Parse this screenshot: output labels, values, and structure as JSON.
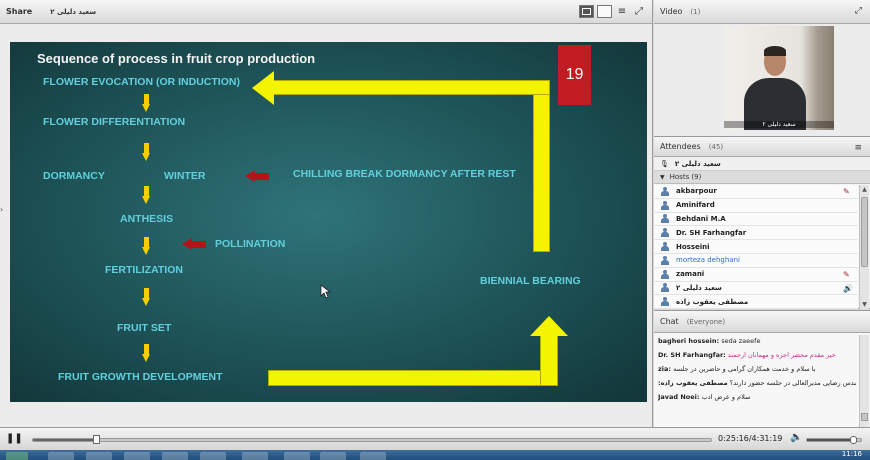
{
  "share": {
    "title": "Share",
    "presenter": "سعید دلیلی ۲"
  },
  "slide": {
    "title": "Sequence of process in fruit crop production",
    "number": "19",
    "steps": [
      "FLOWER EVOCATION (OR INDUCTION)",
      "FLOWER DIFFERENTIATION",
      "DORMANCY",
      "ANTHESIS",
      "FERTILIZATION",
      "FRUIT SET",
      "FRUIT GROWTH DEVELOPMENT"
    ],
    "winter": "WINTER",
    "chilling": "CHILLING BREAK DORMANCY AFTER REST",
    "pollination": "POLLINATION",
    "biennial": "BIENNIAL BEARING"
  },
  "video": {
    "title": "Video",
    "count": "(1)",
    "caption": "سعید دلیلی ۲"
  },
  "attendees": {
    "title": "Attendees",
    "count": "(45)",
    "me": "سعید دلیلی ۲",
    "hosts_label": "Hosts (9)",
    "list": [
      "akbarpour",
      "Aminifard",
      "Behdani M.A",
      "Dr. SH Farhangfar",
      "Hosseini",
      "morteza dehghani",
      "zamani",
      "سعید دلیلی ۲",
      "مصطفی یعقوب زاده"
    ]
  },
  "chat": {
    "title": "Chat",
    "scope": "(Everyone)",
    "messages": [
      {
        "sender": "bagheri hossein:",
        "text": "seda zaeefe"
      },
      {
        "sender": "Dr. SH Farhangfar:",
        "text": "خیر مقدم محضر اجزه و مهمانان ارجمند"
      },
      {
        "sender": "zia:",
        "text": "با سلام و خدمت همکاران گرامی و حاضرین در جلسه"
      },
      {
        "sender": "مصطفی یعقوب زاده:",
        "text": "مهندس رضایی مدیرالعالی در جلسه حضور دارند؟"
      },
      {
        "sender": "Javad Noei:",
        "text": "سلام و عرض ادب"
      }
    ]
  },
  "playback": {
    "time": "0:25:16/4:31:19",
    "progress": 0.093,
    "volume": 0.85
  },
  "taskbar": {
    "clock": "11:16"
  }
}
